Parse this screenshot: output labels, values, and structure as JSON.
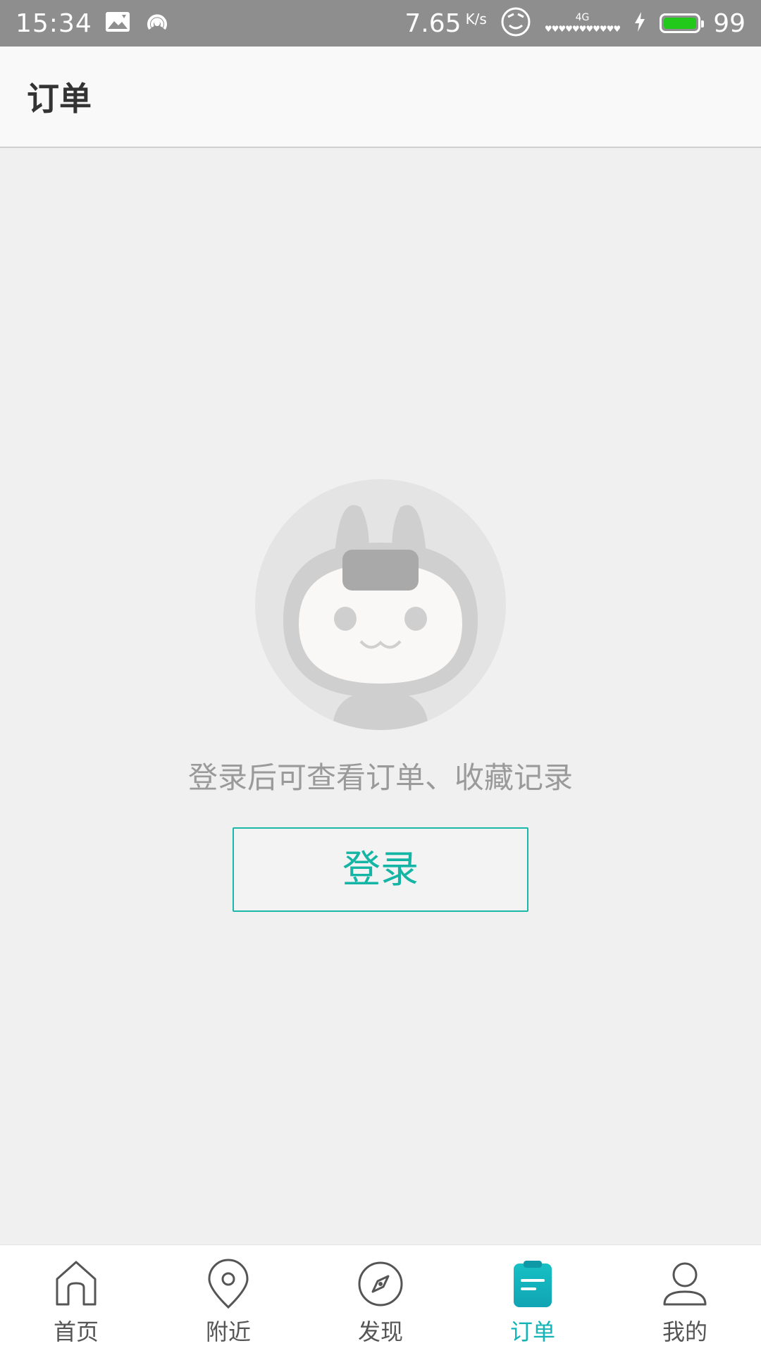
{
  "status_bar": {
    "time": "15:34",
    "speed": "7.65",
    "speed_unit": "K/s",
    "network": "4G",
    "battery_percent": "99",
    "battery_color": "#22c81a"
  },
  "header": {
    "title": "订单"
  },
  "empty_state": {
    "message": "登录后可查看订单、收藏记录",
    "login_button": "登录"
  },
  "tabs": [
    {
      "label": "首页",
      "icon": "home-icon",
      "active": false
    },
    {
      "label": "附近",
      "icon": "location-pin-icon",
      "active": false
    },
    {
      "label": "发现",
      "icon": "compass-icon",
      "active": false
    },
    {
      "label": "订单",
      "icon": "order-list-icon",
      "active": true
    },
    {
      "label": "我的",
      "icon": "user-icon",
      "active": false
    }
  ],
  "colors": {
    "accent": "#14b3b8",
    "button_border": "#1ab8a8"
  }
}
